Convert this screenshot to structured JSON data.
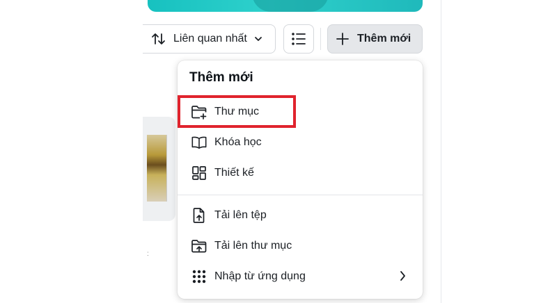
{
  "toolbar": {
    "sort_label": "Liên quan nhất",
    "new_label": "Thêm mới"
  },
  "menu": {
    "title": "Thêm mới",
    "items": [
      {
        "label": "Thư mục",
        "icon": "folder-plus-icon"
      },
      {
        "label": "Khóa học",
        "icon": "book-open-icon"
      },
      {
        "label": "Thiết kế",
        "icon": "design-grid-icon"
      },
      {
        "label": "Tải lên tệp",
        "icon": "file-upload-icon"
      },
      {
        "label": "Tải lên thư mục",
        "icon": "folder-upload-icon"
      },
      {
        "label": "Nhập từ ứng dụng",
        "icon": "apps-grid-icon"
      }
    ]
  },
  "colors": {
    "accent": "#17c1c0",
    "highlight": "#e0232d",
    "button_bg": "#e5e7ea"
  }
}
